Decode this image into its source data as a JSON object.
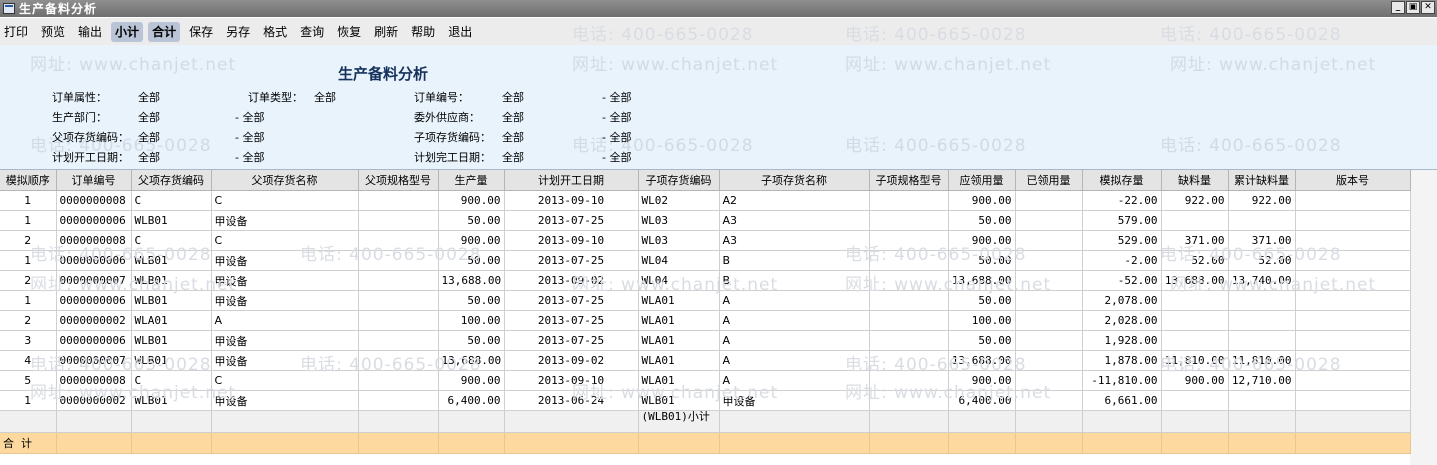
{
  "window": {
    "title": "生产备料分析",
    "controls": [
      "_",
      "▣",
      "✕"
    ]
  },
  "menu": [
    {
      "label": "打印",
      "active": false
    },
    {
      "label": "预览",
      "active": false
    },
    {
      "label": "输出",
      "active": false
    },
    {
      "label": "小计",
      "active": true
    },
    {
      "label": "合计",
      "active": true
    },
    {
      "label": "保存",
      "active": false
    },
    {
      "label": "另存",
      "active": false
    },
    {
      "label": "格式",
      "active": false
    },
    {
      "label": "查询",
      "active": false
    },
    {
      "label": "恢复",
      "active": false
    },
    {
      "label": "刷新",
      "active": false
    },
    {
      "label": "帮助",
      "active": false
    },
    {
      "label": "退出",
      "active": false
    }
  ],
  "report": {
    "title": "生产备料分析"
  },
  "filters": {
    "order_attr_label": "订单属性：",
    "order_attr_value": "全部",
    "order_type_label": "订单类型：",
    "order_type_value": "全部",
    "order_no_label": "订单编号：",
    "order_no_from": "全部",
    "order_no_to": "- 全部",
    "prod_dept_label": "生产部门：",
    "prod_dept_from": "全部",
    "prod_dept_to": "- 全部",
    "outsource_label": "委外供应商：",
    "outsource_from": "全部",
    "outsource_to": "- 全部",
    "parent_code_label": "父项存货编码：",
    "parent_code_from": "全部",
    "parent_code_to": "- 全部",
    "child_code_label": "子项存货编码：",
    "child_code_from": "全部",
    "child_code_to": "- 全部",
    "plan_start_label": "计划开工日期：",
    "plan_start_from": "全部",
    "plan_start_to": "- 全部",
    "plan_end_label": "计划完工日期：",
    "plan_end_from": "全部",
    "plan_end_to": "- 全部"
  },
  "watermark": {
    "phone": "电话: 400-665-0028",
    "site": "网址: www.chanjet.net"
  },
  "table": {
    "columns": [
      "模拟顺序",
      "订单编号",
      "父项存货编码",
      "父项存货名称",
      "父项规格型号",
      "生产量",
      "计划开工日期",
      "子项存货编码",
      "子项存货名称",
      "子项规格型号",
      "应领用量",
      "已领用量",
      "模拟存量",
      "缺料量",
      "累计缺料量",
      "版本号"
    ],
    "rows": [
      [
        "1",
        "0000000008",
        "C",
        "C",
        "",
        "900.00",
        "2013-09-10",
        "WL02",
        "A2",
        "",
        "900.00",
        "",
        "-22.00",
        "922.00",
        "922.00",
        ""
      ],
      [
        "1",
        "0000000006",
        "WLB01",
        "甲设备",
        "",
        "50.00",
        "2013-07-25",
        "WL03",
        "A3",
        "",
        "50.00",
        "",
        "579.00",
        "",
        "",
        ""
      ],
      [
        "2",
        "0000000008",
        "C",
        "C",
        "",
        "900.00",
        "2013-09-10",
        "WL03",
        "A3",
        "",
        "900.00",
        "",
        "529.00",
        "371.00",
        "371.00",
        ""
      ],
      [
        "1",
        "0000000006",
        "WLB01",
        "甲设备",
        "",
        "50.00",
        "2013-07-25",
        "WL04",
        "B",
        "",
        "50.00",
        "",
        "-2.00",
        "52.00",
        "52.00",
        ""
      ],
      [
        "2",
        "0000000007",
        "WLB01",
        "甲设备",
        "",
        "13,688.00",
        "2013-09-02",
        "WL04",
        "B",
        "",
        "13,688.00",
        "",
        "-52.00",
        "13,688.00",
        "13,740.00",
        ""
      ],
      [
        "1",
        "0000000006",
        "WLB01",
        "甲设备",
        "",
        "50.00",
        "2013-07-25",
        "WLA01",
        "A",
        "",
        "50.00",
        "",
        "2,078.00",
        "",
        "",
        ""
      ],
      [
        "2",
        "0000000002",
        "WLA01",
        "A",
        "",
        "100.00",
        "2013-07-25",
        "WLA01",
        "A",
        "",
        "100.00",
        "",
        "2,028.00",
        "",
        "",
        ""
      ],
      [
        "3",
        "0000000006",
        "WLB01",
        "甲设备",
        "",
        "50.00",
        "2013-07-25",
        "WLA01",
        "A",
        "",
        "50.00",
        "",
        "1,928.00",
        "",
        "",
        ""
      ],
      [
        "4",
        "0000000007",
        "WLB01",
        "甲设备",
        "",
        "13,688.00",
        "2013-09-02",
        "WLA01",
        "A",
        "",
        "13,688.00",
        "",
        "1,878.00",
        "11,810.00",
        "11,810.00",
        ""
      ],
      [
        "5",
        "0000000008",
        "C",
        "C",
        "",
        "900.00",
        "2013-09-10",
        "WLA01",
        "A",
        "",
        "900.00",
        "",
        "-11,810.00",
        "900.00",
        "12,710.00",
        ""
      ],
      [
        "1",
        "0000000002",
        "WLB01",
        "甲设备",
        "",
        "6,400.00",
        "2013-06-24",
        "WLB01",
        "甲设备",
        "",
        "6,400.00",
        "",
        "6,661.00",
        "",
        "",
        ""
      ]
    ],
    "subtotal_label": "(WLB01)小计",
    "total_label": "合  计"
  }
}
